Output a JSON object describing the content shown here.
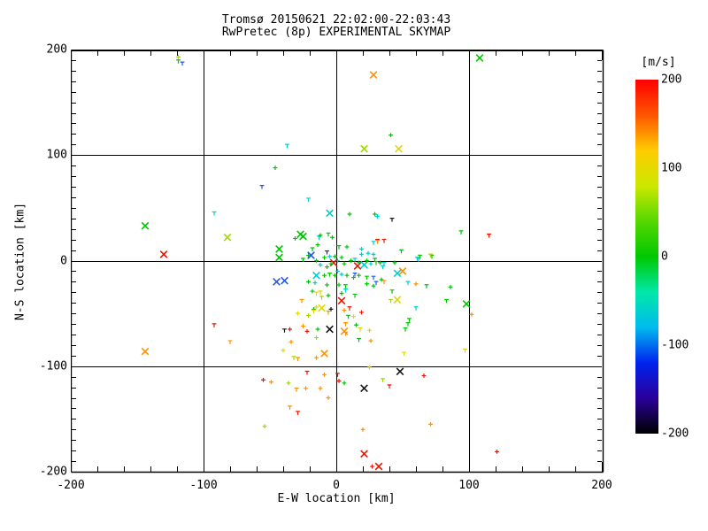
{
  "title": {
    "line1": "Tromsø 20150621 22:02:00-22:03:43",
    "line2": "RwPretec (8p) EXPERIMENTAL SKYMAP"
  },
  "chart_data": {
    "type": "scatter",
    "title": "Tromsø 20150621 22:02:00-22:03:43",
    "subtitle": "RwPretec (8p) EXPERIMENTAL SKYMAP",
    "xlabel": "E-W location [km]",
    "ylabel": "N-S location [km]",
    "xlim": [
      -200,
      200
    ],
    "ylim": [
      -200,
      200
    ],
    "xticks": [
      "-200",
      "-100",
      "0",
      "100",
      "200"
    ],
    "yticks": [
      "200",
      "100",
      "0",
      "-100",
      "-200"
    ],
    "xtick_values": [
      -200,
      -100,
      0,
      100,
      200
    ],
    "ytick_values": [
      200,
      100,
      0,
      -100,
      -200
    ],
    "x_minor_step": 20,
    "y_minor_step": 10,
    "grid": true,
    "grid_values": [
      -100,
      0,
      100
    ],
    "legend_position": "colorbar-right",
    "colorbar": {
      "unit": "[m/s]",
      "min": -200,
      "max": 200,
      "ticks": [
        "200",
        "100",
        "0",
        "-100",
        "-200"
      ],
      "tick_values": [
        200,
        100,
        0,
        -100,
        -200
      ],
      "gradient_top_to_bottom": [
        "#ff0000",
        "#ff5500",
        "#ffcc00",
        "#cce800",
        "#55d800",
        "#00c800",
        "#00e8a8",
        "#00bbee",
        "#0022ee",
        "#2a0099",
        "#000000"
      ]
    },
    "palette": {
      "g": "#00c400",
      "c": "#00cdcd",
      "y": "#ddd800",
      "yg": "#9ed900",
      "o": "#ff9000",
      "r": "#e81400",
      "b": "#2257ee",
      "k": "#141414",
      "pu": "#550099"
    },
    "marker_shapes": {
      "x": "large-cross",
      "p": "small-plus",
      "t": "small-tee"
    },
    "points": [
      [
        -119,
        193,
        "yg",
        "p"
      ],
      [
        -119,
        189,
        "g",
        "t"
      ],
      [
        -116,
        187,
        "b",
        "t"
      ],
      [
        108,
        192,
        "g",
        "x"
      ],
      [
        28,
        176,
        "o",
        "x"
      ],
      [
        41,
        119,
        "g",
        "p"
      ],
      [
        21,
        106,
        "yg",
        "x"
      ],
      [
        47,
        106,
        "y",
        "x"
      ],
      [
        -37,
        109,
        "c",
        "t"
      ],
      [
        -46,
        88,
        "g",
        "p"
      ],
      [
        -21,
        58,
        "c",
        "t"
      ],
      [
        -56,
        70,
        "b",
        "t"
      ],
      [
        -92,
        45,
        "c",
        "t"
      ],
      [
        -144,
        33,
        "g",
        "x"
      ],
      [
        -130,
        6,
        "r",
        "x"
      ],
      [
        -82,
        22,
        "yg",
        "x"
      ],
      [
        -144,
        -86,
        "o",
        "x"
      ],
      [
        -80,
        -77,
        "o",
        "t"
      ],
      [
        94,
        27,
        "g",
        "t"
      ],
      [
        115,
        24,
        "r",
        "t"
      ],
      [
        61,
        2,
        "c",
        "t"
      ],
      [
        72,
        4,
        "g",
        "t"
      ],
      [
        71,
        5,
        "yg",
        "t"
      ],
      [
        54,
        -21,
        "c",
        "t"
      ],
      [
        60,
        -22,
        "o",
        "p"
      ],
      [
        68,
        -24,
        "g",
        "t"
      ],
      [
        86,
        -25,
        "g",
        "p"
      ],
      [
        83,
        -38,
        "g",
        "t"
      ],
      [
        98,
        -41,
        "g",
        "x"
      ],
      [
        60,
        -45,
        "c",
        "t"
      ],
      [
        102,
        -51,
        "o",
        "p"
      ],
      [
        54,
        -60,
        "g",
        "t"
      ],
      [
        97,
        -85,
        "y",
        "t"
      ],
      [
        -5,
        45,
        "c",
        "x"
      ],
      [
        10,
        44,
        "g",
        "p"
      ],
      [
        29,
        44,
        "g",
        "p"
      ],
      [
        31,
        42,
        "c",
        "p"
      ],
      [
        42,
        39,
        "k",
        "t"
      ],
      [
        -27,
        25,
        "g",
        "x"
      ],
      [
        -31,
        21,
        "g",
        "p"
      ],
      [
        -13,
        22,
        "c",
        "t"
      ],
      [
        -43,
        11,
        "g",
        "x"
      ],
      [
        -43,
        3,
        "g",
        "x"
      ],
      [
        -25,
        23,
        "g",
        "x"
      ],
      [
        -12,
        24,
        "g",
        "p"
      ],
      [
        -6,
        25,
        "g",
        "t"
      ],
      [
        -3,
        22,
        "g",
        "p"
      ],
      [
        49,
        9,
        "g",
        "t"
      ],
      [
        44,
        -2,
        "g",
        "p"
      ],
      [
        62,
        1,
        "c",
        "t"
      ],
      [
        63,
        4,
        "g",
        "t"
      ],
      [
        19,
        6,
        "c",
        "p"
      ],
      [
        28,
        6,
        "c",
        "p"
      ],
      [
        2,
        13,
        "g",
        "t"
      ],
      [
        8,
        13,
        "g",
        "p"
      ],
      [
        19,
        11,
        "c",
        "p"
      ],
      [
        24,
        7,
        "c",
        "p"
      ],
      [
        28,
        17,
        "c",
        "t"
      ],
      [
        31,
        19,
        "r",
        "t"
      ],
      [
        31,
        18,
        "o",
        "t"
      ],
      [
        36,
        19,
        "r",
        "t"
      ],
      [
        -14,
        15,
        "g",
        "p"
      ],
      [
        -18,
        11,
        "g",
        "t"
      ],
      [
        -21,
        5,
        "g",
        "p"
      ],
      [
        -25,
        1,
        "g",
        "t"
      ],
      [
        -15,
        0,
        "g",
        "p"
      ],
      [
        -9,
        3,
        "g",
        "p"
      ],
      [
        -5,
        4,
        "c",
        "p"
      ],
      [
        -1,
        4,
        "g",
        "p"
      ],
      [
        4,
        3,
        "g",
        "p"
      ],
      [
        1,
        0,
        "c",
        "p"
      ],
      [
        -7,
        8,
        "pu",
        "t"
      ],
      [
        -19,
        5,
        "b",
        "x"
      ],
      [
        -2,
        -2,
        "r",
        "x"
      ],
      [
        16,
        -5,
        "r",
        "x"
      ],
      [
        21,
        -4,
        "c",
        "x"
      ],
      [
        -4,
        -3,
        "g",
        "p"
      ],
      [
        -7,
        -6,
        "g",
        "p"
      ],
      [
        -12,
        -4,
        "c",
        "p"
      ],
      [
        6,
        -3,
        "g",
        "p"
      ],
      [
        11,
        0,
        "g",
        "p"
      ],
      [
        14,
        1,
        "c",
        "t"
      ],
      [
        17,
        -2,
        "g",
        "p"
      ],
      [
        23,
        0,
        "g",
        "p"
      ],
      [
        26,
        -3,
        "c",
        "p"
      ],
      [
        29,
        1,
        "g",
        "t"
      ],
      [
        33,
        -2,
        "g",
        "p"
      ],
      [
        36,
        -3,
        "c",
        "t"
      ],
      [
        30,
        -2,
        "g",
        "t"
      ],
      [
        35,
        -6,
        "c",
        "t"
      ],
      [
        28,
        -16,
        "b",
        "t"
      ],
      [
        -15,
        -14,
        "c",
        "x"
      ],
      [
        -45,
        -20,
        "b",
        "x"
      ],
      [
        -39,
        -19,
        "b",
        "x"
      ],
      [
        -9,
        -14,
        "g",
        "p"
      ],
      [
        -5,
        -13,
        "g",
        "t"
      ],
      [
        -1,
        -14,
        "g",
        "p"
      ],
      [
        4,
        -13,
        "c",
        "p"
      ],
      [
        8,
        -14,
        "g",
        "p"
      ],
      [
        13,
        -16,
        "g",
        "p"
      ],
      [
        17,
        -14,
        "g",
        "p"
      ],
      [
        23,
        -16,
        "g",
        "t"
      ],
      [
        1,
        -10,
        "c",
        "p"
      ],
      [
        14,
        -13,
        "b",
        "t"
      ],
      [
        -21,
        -20,
        "g",
        "p"
      ],
      [
        -16,
        -21,
        "c",
        "p"
      ],
      [
        -7,
        -23,
        "g",
        "p"
      ],
      [
        2,
        -23,
        "g",
        "p"
      ],
      [
        7,
        -24,
        "g",
        "t"
      ],
      [
        23,
        -22,
        "g",
        "p"
      ],
      [
        28,
        -24,
        "g",
        "p"
      ],
      [
        34,
        -18,
        "g",
        "p"
      ],
      [
        30,
        -21,
        "b",
        "t"
      ],
      [
        36,
        -20,
        "o",
        "t"
      ],
      [
        -18,
        -29,
        "g",
        "p"
      ],
      [
        -12,
        -30,
        "y",
        "t"
      ],
      [
        -15,
        -31,
        "y",
        "t"
      ],
      [
        -6,
        -33,
        "g",
        "p"
      ],
      [
        4,
        -31,
        "g",
        "p"
      ],
      [
        14,
        -33,
        "g",
        "t"
      ],
      [
        7,
        -28,
        "c",
        "t"
      ],
      [
        42,
        -29,
        "g",
        "t"
      ],
      [
        41,
        -38,
        "yg",
        "t"
      ],
      [
        46,
        -37,
        "y",
        "x"
      ],
      [
        46,
        -12,
        "c",
        "x"
      ],
      [
        50,
        -10,
        "o",
        "x"
      ],
      [
        -26,
        -38,
        "o",
        "t"
      ],
      [
        -11,
        -35,
        "yg",
        "t"
      ],
      [
        -11,
        -45,
        "y",
        "x"
      ],
      [
        -15,
        -44,
        "y",
        "p"
      ],
      [
        -17,
        -46,
        "g",
        "p"
      ],
      [
        4,
        -38,
        "r",
        "x"
      ],
      [
        10,
        -45,
        "r",
        "t"
      ],
      [
        -4,
        -46,
        "k",
        "p"
      ],
      [
        6,
        -47,
        "o",
        "p"
      ],
      [
        -29,
        -50,
        "y",
        "p"
      ],
      [
        -21,
        -52,
        "yg",
        "p"
      ],
      [
        -17,
        -48,
        "y",
        "t"
      ],
      [
        -6,
        -49,
        "o",
        "t"
      ],
      [
        -5,
        -65,
        "k",
        "x"
      ],
      [
        -92,
        -61,
        "r",
        "t"
      ],
      [
        -39,
        -66,
        "k",
        "t"
      ],
      [
        -35,
        -65,
        "r",
        "p"
      ],
      [
        -25,
        -62,
        "o",
        "p"
      ],
      [
        -22,
        -67,
        "r",
        "p"
      ],
      [
        -14,
        -65,
        "g",
        "p"
      ],
      [
        7,
        -60,
        "o",
        "t"
      ],
      [
        6,
        -67,
        "o",
        "x"
      ],
      [
        15,
        -61,
        "g",
        "p"
      ],
      [
        13,
        -53,
        "y",
        "p"
      ],
      [
        19,
        -49,
        "r",
        "p"
      ],
      [
        9,
        -53,
        "g",
        "t"
      ],
      [
        18,
        -65,
        "y",
        "t"
      ],
      [
        7,
        -69,
        "o",
        "t"
      ],
      [
        25,
        -66,
        "y",
        "p"
      ],
      [
        17,
        -75,
        "g",
        "t"
      ],
      [
        26,
        -76,
        "o",
        "p"
      ],
      [
        -15,
        -73,
        "yg",
        "p"
      ],
      [
        -34,
        -77,
        "o",
        "p"
      ],
      [
        -40,
        -85,
        "y",
        "p"
      ],
      [
        -32,
        -92,
        "yg",
        "t"
      ],
      [
        -29,
        -93,
        "o",
        "t"
      ],
      [
        -15,
        -92,
        "o",
        "p"
      ],
      [
        -9,
        -88,
        "o",
        "x"
      ],
      [
        -22,
        -106,
        "r",
        "t"
      ],
      [
        -9,
        -108,
        "o",
        "p"
      ],
      [
        48,
        -105,
        "k",
        "x"
      ],
      [
        21,
        -121,
        "k",
        "x"
      ],
      [
        2,
        -114,
        "r",
        "p"
      ],
      [
        6,
        -116,
        "g",
        "p"
      ],
      [
        1,
        -108,
        "r",
        "t"
      ],
      [
        -30,
        -122,
        "o",
        "t"
      ],
      [
        -23,
        -121,
        "o",
        "p"
      ],
      [
        -55,
        -113,
        "r",
        "p"
      ],
      [
        -49,
        -115,
        "o",
        "p"
      ],
      [
        -36,
        -116,
        "yg",
        "p"
      ],
      [
        -12,
        -121,
        "o",
        "p"
      ],
      [
        -6,
        -130,
        "o",
        "p"
      ],
      [
        40,
        -119,
        "r",
        "t"
      ],
      [
        25,
        -101,
        "y",
        "p"
      ],
      [
        35,
        -113,
        "yg",
        "t"
      ],
      [
        51,
        -88,
        "y",
        "t"
      ],
      [
        55,
        -56,
        "g",
        "t"
      ],
      [
        52,
        -65,
        "g",
        "t"
      ],
      [
        -35,
        -139,
        "o",
        "t"
      ],
      [
        -29,
        -144,
        "r",
        "t"
      ],
      [
        -54,
        -157,
        "yg",
        "p"
      ],
      [
        20,
        -160,
        "o",
        "p"
      ],
      [
        21,
        -183,
        "r",
        "x"
      ],
      [
        27,
        -195,
        "r",
        "p"
      ],
      [
        32,
        -195,
        "r",
        "x"
      ],
      [
        66,
        -109,
        "r",
        "p"
      ],
      [
        71,
        -155,
        "o",
        "p"
      ],
      [
        121,
        -181,
        "r",
        "p"
      ]
    ]
  }
}
